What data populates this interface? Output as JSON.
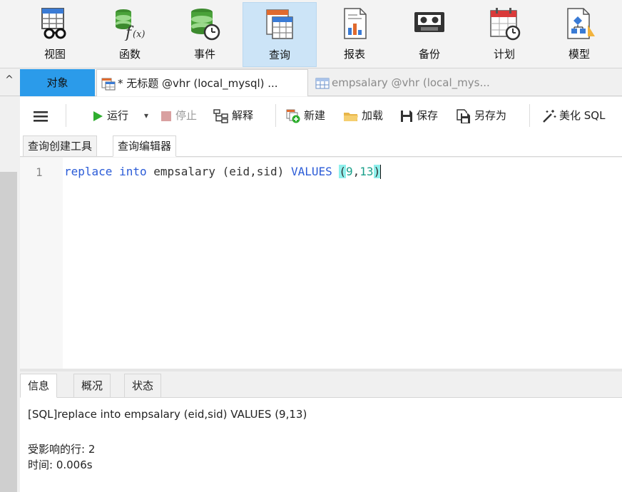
{
  "main_toolbar": [
    {
      "label": "视图",
      "icon": "view-icon"
    },
    {
      "label": "函数",
      "icon": "function-icon"
    },
    {
      "label": "事件",
      "icon": "event-icon"
    },
    {
      "label": "查询",
      "icon": "query-icon",
      "active": true
    },
    {
      "label": "报表",
      "icon": "report-icon"
    },
    {
      "label": "备份",
      "icon": "backup-icon"
    },
    {
      "label": "计划",
      "icon": "schedule-icon"
    },
    {
      "label": "模型",
      "icon": "model-icon"
    }
  ],
  "tabs": {
    "collapse_glyph": "^",
    "objects": "对象",
    "untitled": "* 无标题 @vhr (local_mysql) ...",
    "empsalary": "empsalary @vhr (local_mys..."
  },
  "sub_toolbar": {
    "run": "运行",
    "dropdown_glyph": "▾",
    "stop": "停止",
    "explain": "解释",
    "new": "新建",
    "load": "加载",
    "save": "保存",
    "save_as": "另存为",
    "beautify": "美化 SQL"
  },
  "inner_tabs": {
    "builder": "查询创建工具",
    "editor": "查询编辑器"
  },
  "editor": {
    "line_number": "1",
    "tokens": {
      "replace": "replace",
      "into": "into",
      "table": "empsalary",
      "columns": "(eid,sid)",
      "values": "VALUES",
      "open_paren": "(",
      "v1": "9",
      "comma": ",",
      "v2": "13",
      "close_paren": ")"
    }
  },
  "result_tabs": {
    "info": "信息",
    "overview": "概况",
    "status": "状态"
  },
  "result": {
    "sql_line": "[SQL]replace into empsalary (eid,sid) VALUES (9,13)",
    "affected_rows": "受影响的行: 2",
    "time": "时间: 0.006s"
  },
  "colors": {
    "accent": "#2b9bea",
    "active_toolbar": "#cce4f7",
    "keyword": "#2a5bd7",
    "number": "#1aa08a",
    "bracket_highlight": "#8ff0ec",
    "run_green": "#2fae2f",
    "stop_red": "#d9a0a0"
  }
}
